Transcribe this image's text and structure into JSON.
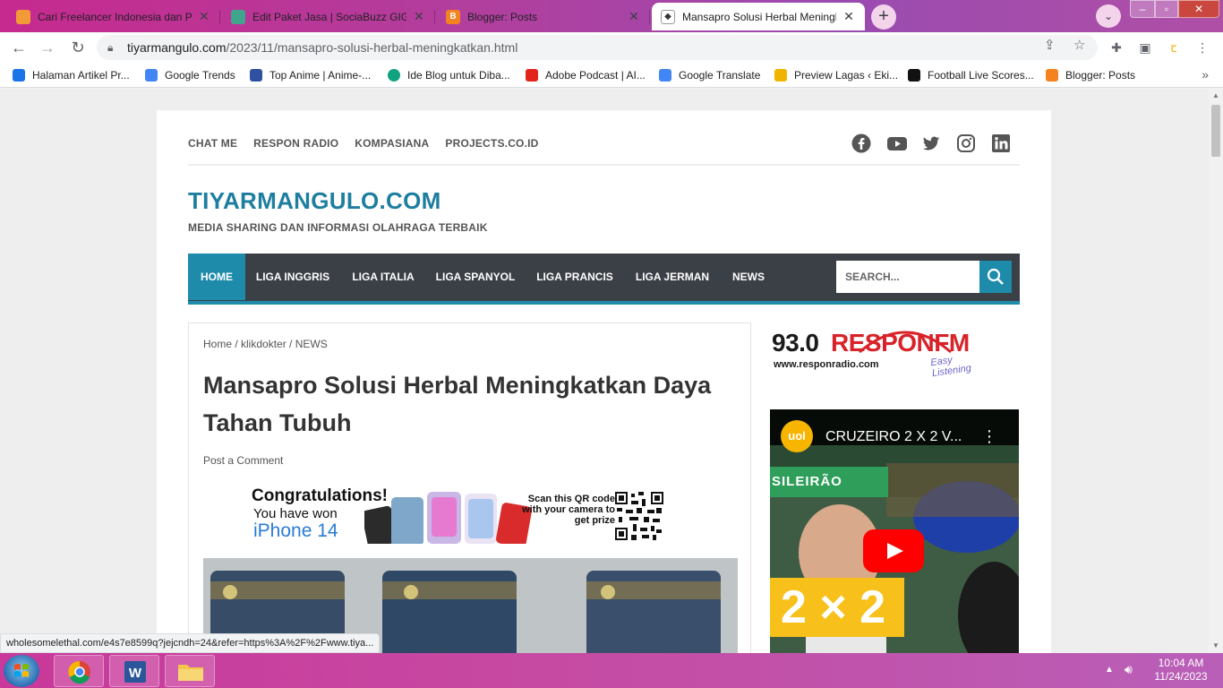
{
  "browser": {
    "tabs": [
      {
        "title": "Cari Freelancer Indonesia dan Pe",
        "favicon_color": "#f29a38"
      },
      {
        "title": "Edit Paket Jasa | SociaBuzz GIGS",
        "favicon_color": "#3fa58c"
      },
      {
        "title": "Blogger: Posts",
        "favicon_color": "#f58220"
      },
      {
        "title": "Mansapro Solusi Herbal Meningk",
        "favicon_color": "#333333",
        "active": true
      }
    ],
    "new_tab_label": "+",
    "url_host": "tiyarmangulo.com",
    "url_path": "/2023/11/mansapro-solusi-herbal-meningkatkan.html",
    "bookmarks": [
      {
        "label": "Halaman Artikel Pr...",
        "color": "#1a73e8"
      },
      {
        "label": "Google Trends",
        "color": "#4285f4"
      },
      {
        "label": "Top Anime | Anime-...",
        "color": "#2e51a2"
      },
      {
        "label": "Ide Blog untuk Diba...",
        "color": "#10a37f"
      },
      {
        "label": "Adobe Podcast | AI...",
        "color": "#e1251b"
      },
      {
        "label": "Google Translate",
        "color": "#4285f4"
      },
      {
        "label": "Preview Lagas ‹ Eki...",
        "color": "#f0b400"
      },
      {
        "label": "Football Live Scores...",
        "color": "#111111"
      },
      {
        "label": "Blogger: Posts",
        "color": "#f58220"
      }
    ],
    "bookmarks_more": "»",
    "status_link": "wholesomelethal.com/e4s7e8599q?jejcndh=24&refer=https%3A%2F%2Fwww.tiya..."
  },
  "site": {
    "top_links": [
      "CHAT ME",
      "RESPON RADIO",
      "KOMPASIANA",
      "PROJECTS.CO.ID"
    ],
    "title": "TIYARMANGULO.COM",
    "tagline": "MEDIA SHARING DAN INFORMASI OLAHRAGA TERBAIK",
    "nav": [
      "HOME",
      "LIGA INGGRIS",
      "LIGA ITALIA",
      "LIGA SPANYOL",
      "LIGA PRANCIS",
      "LIGA JERMAN",
      "NEWS"
    ],
    "search_placeholder": "SEARCH...",
    "accent": "#1e8bab"
  },
  "article": {
    "breadcrumb": "Home / klikdokter / NEWS",
    "title": "Mansapro Solusi Herbal Meningkatkan Daya Tahan Tubuh",
    "post_comment": "Post a Comment",
    "ad": {
      "line1": "Congratulations!",
      "line2": "You have won",
      "line3": "iPhone 14",
      "scan": "Scan this QR code with your camera to get prize"
    }
  },
  "sidebar": {
    "radio_freq": "93.0",
    "radio_name": "RESPONFM",
    "radio_url": "www.responradio.com",
    "radio_tag": "Easy Listening",
    "video_channel": "uol",
    "video_title": "CRUZEIRO 2 X 2 V...",
    "video_label": "SILEIRÃO",
    "video_score": "2 × 2"
  },
  "taskbar": {
    "time": "10:04 AM",
    "date": "11/24/2023"
  }
}
